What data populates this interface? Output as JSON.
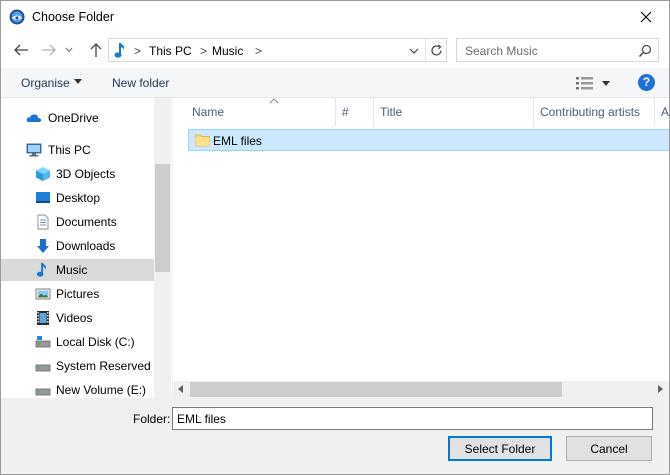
{
  "window": {
    "title": "Choose Folder",
    "app_icon": "thunderbird-icon",
    "close_icon": "close-icon"
  },
  "nav": {
    "back_icon": "arrow-left-icon",
    "forward_icon": "arrow-right-icon",
    "recent_icon": "chevron-down-icon",
    "up_icon": "arrow-up-icon",
    "breadcrumb": [
      "This PC",
      "Music"
    ],
    "refresh_icon": "refresh-icon",
    "search_placeholder": "Search Music",
    "search_icon": "search-icon"
  },
  "commands": {
    "organise": "Organise",
    "new_folder": "New folder",
    "view_icon": "details-view-icon",
    "help_label": "?"
  },
  "sidebar": {
    "items": [
      {
        "label": "OneDrive",
        "icon": "onedrive-icon"
      },
      {
        "label": "This PC",
        "icon": "computer-icon"
      },
      {
        "label": "3D Objects",
        "icon": "cube-icon"
      },
      {
        "label": "Desktop",
        "icon": "desktop-icon"
      },
      {
        "label": "Documents",
        "icon": "document-icon"
      },
      {
        "label": "Downloads",
        "icon": "download-icon"
      },
      {
        "label": "Music",
        "icon": "music-icon",
        "selected": true
      },
      {
        "label": "Pictures",
        "icon": "pictures-icon"
      },
      {
        "label": "Videos",
        "icon": "video-icon"
      },
      {
        "label": "Local Disk (C:)",
        "icon": "drive-icon"
      },
      {
        "label": "System Reserved (D",
        "icon": "drive-icon"
      },
      {
        "label": "New Volume (E:)",
        "icon": "drive-icon"
      }
    ]
  },
  "files": {
    "columns": [
      "Name",
      "#",
      "Title",
      "Contributing artists",
      "A"
    ],
    "rows": [
      {
        "name": "EML files",
        "icon": "folder-icon"
      }
    ]
  },
  "footer": {
    "folder_label": "Folder:",
    "folder_value": "EML files",
    "select_button": "Select Folder",
    "cancel_button": "Cancel"
  },
  "colors": {
    "accent": "#0078d7",
    "selection": "#cce8ff",
    "selection_border": "#99d1ff",
    "nav_selected": "#d9d9d9",
    "link_blue": "#1e395b"
  }
}
